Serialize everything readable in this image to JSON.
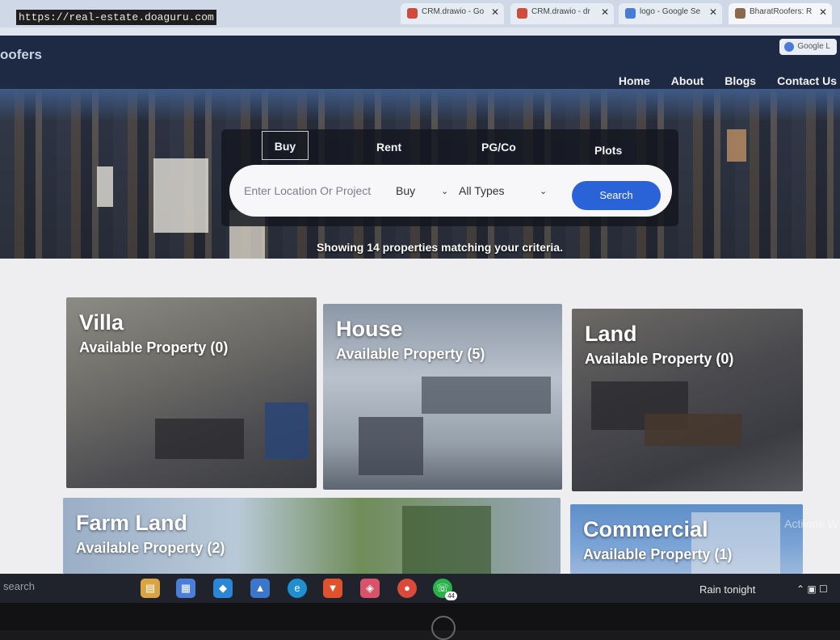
{
  "browser": {
    "url": "https://real-estate.doaguru.com",
    "tabs": [
      {
        "label": "CRM.drawio - Go",
        "color": "#d04b3c"
      },
      {
        "label": "CRM.drawio - dr",
        "color": "#d04b3c"
      },
      {
        "label": "logo - Google Se",
        "color": "#4b7bd8"
      },
      {
        "label": "BharatRoofers: R",
        "color": "#8a6a4a"
      }
    ],
    "google_pill": "Google L"
  },
  "site": {
    "brand": "oofers",
    "nav": [
      "Home",
      "About",
      "Blogs",
      "Contact Us"
    ]
  },
  "search": {
    "tabs": [
      "Buy",
      "Rent",
      "PG/Co",
      "Plots"
    ],
    "active_tab": "Buy",
    "placeholder": "Enter Location Or Project",
    "mode_value": "Buy",
    "type_value": "All Types",
    "button": "Search",
    "results_text": "Showing 14 properties matching your criteria."
  },
  "cards": [
    {
      "title": "Villa",
      "subtitle": "Available Property (0)"
    },
    {
      "title": "House",
      "subtitle": "Available Property (5)"
    },
    {
      "title": "Land",
      "subtitle": "Available Property (0)"
    },
    {
      "title": "Farm Land",
      "subtitle": "Available Property (2)"
    },
    {
      "title": "Commercial",
      "subtitle": "Available Property (1)"
    }
  ],
  "overlay": {
    "activate": "Activate W"
  },
  "taskbar": {
    "search": "search",
    "weather": "Rain tonight",
    "whatsapp_badge": "44",
    "accent": "#2a63d8"
  }
}
